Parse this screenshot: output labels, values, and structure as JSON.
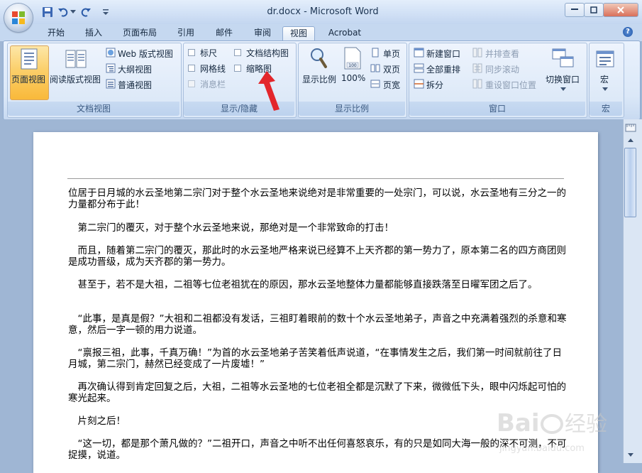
{
  "window": {
    "title": "dr.docx - Microsoft Word"
  },
  "tabs": [
    {
      "label": "开始"
    },
    {
      "label": "插入"
    },
    {
      "label": "页面布局"
    },
    {
      "label": "引用"
    },
    {
      "label": "邮件"
    },
    {
      "label": "审阅"
    },
    {
      "label": "视图",
      "active": true
    },
    {
      "label": "Acrobat"
    }
  ],
  "ribbon": {
    "doc_views": {
      "label": "文档视图",
      "print_layout": "页面视图",
      "reading": "阅读版式视图",
      "web": "Web 版式视图",
      "outline": "大纲视图",
      "draft": "普通视图"
    },
    "show_hide": {
      "label": "显示/隐藏",
      "ruler": "标尺",
      "gridlines": "网格线",
      "message_bar": "消息栏",
      "doc_map": "文档结构图",
      "thumbnails": "缩略图"
    },
    "zoom": {
      "label": "显示比例",
      "zoom": "显示比例",
      "pct": "100%",
      "one_page": "单页",
      "two_pages": "双页",
      "page_width": "页宽"
    },
    "window": {
      "label": "窗口",
      "new_window": "新建窗口",
      "arrange_all": "全部重排",
      "split": "拆分",
      "side_by_side": "并排查看",
      "sync_scroll": "同步滚动",
      "reset_pos": "重设窗口位置",
      "switch": "切换窗口"
    },
    "macros": {
      "label": "宏",
      "macros": "宏"
    }
  },
  "document": {
    "paragraphs": [
      "位居于日月城的水云圣地第二宗门对于整个水云圣地来说绝对是非常重要的一处宗门，可以说，水云圣地有三分之一的力量都分布于此！",
      "　第二宗门的覆灭，对于整个水云圣地来说，那绝对是一个非常致命的打击！",
      "　而且，随着第二宗门的覆灭，那此时的水云圣地严格来说已经算不上天齐郡的第一势力了，原本第二名的四方商团则是成功晋级，成为天齐郡的第一势力。",
      "　甚至于，若不是大祖，二祖等七位老祖犹在的原因，那水云圣地整体力量都能够直接跌落至日曜军团之后了。",
      "　“此事，是真是假？”大祖和二祖都没有发话，三祖盯着眼前的数十个水云圣地弟子，声音之中充满着强烈的杀意和寒意，然后一字一顿的用力说道。",
      "　“禀报三祖，此事，千真万确！”为首的水云圣地弟子苦笑着低声说道，“在事情发生之后，我们第一时间就前往了日月城，第二宗门，赫然已经变成了一片废墟！”",
      "　再次确认得到肯定回复之后，大祖，二祖等水云圣地的七位老祖全都是沉默了下来，微微低下头，眼中闪烁起可怕的寒光起来。",
      "　片刻之后！",
      "　“这一切，都是那个萧凡做的？”二祖开口，声音之中听不出任何喜怒哀乐，有的只是如同大海一般的深不可测，不可捉摸，说道。"
    ]
  },
  "watermark": {
    "text": "Baidu 经验",
    "sub": "jingyan.baidu.com"
  }
}
